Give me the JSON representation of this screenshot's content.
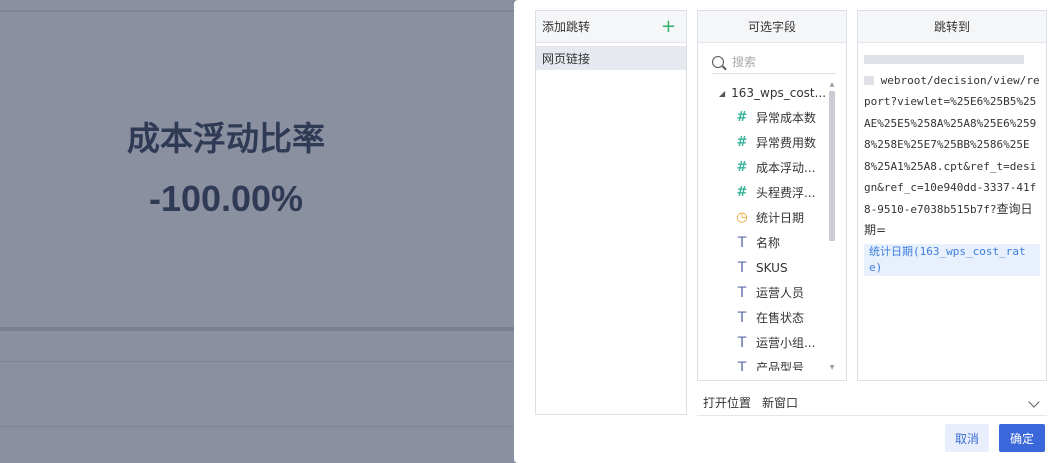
{
  "background": {
    "title": "成本浮动比率",
    "value": "-100.00%"
  },
  "jump_list": {
    "header": "添加跳转",
    "add_icon": "plus-icon",
    "items": [
      {
        "label": "网页链接"
      }
    ]
  },
  "fields": {
    "header": "可选字段",
    "search_placeholder": "搜索",
    "root_label": "163_wps_cost...",
    "items": [
      {
        "label": "异常成本数",
        "type": "number",
        "icon": "hash-icon"
      },
      {
        "label": "异常费用数",
        "type": "number",
        "icon": "hash-icon"
      },
      {
        "label": "成本浮动...",
        "type": "number",
        "icon": "hash-icon"
      },
      {
        "label": "头程费浮...",
        "type": "number",
        "icon": "hash-icon"
      },
      {
        "label": "统计日期",
        "type": "date",
        "icon": "clock-icon"
      },
      {
        "label": "名称",
        "type": "text",
        "icon": "text-type-icon"
      },
      {
        "label": "SKUS",
        "type": "text",
        "icon": "text-type-icon"
      },
      {
        "label": "运营人员",
        "type": "text",
        "icon": "text-type-icon"
      },
      {
        "label": "在售状态",
        "type": "text",
        "icon": "text-type-icon"
      },
      {
        "label": "运营小组...",
        "type": "text",
        "icon": "text-type-icon"
      },
      {
        "label": "产品型号",
        "type": "text",
        "icon": "text-type-icon"
      }
    ]
  },
  "jump_to": {
    "header": "跳转到",
    "url_path": "webroot/decision/view/report?viewlet=%25E6%25B5%25AE%25E5%258A%25A8%25E6%2598%258E%25E7%25BB%2586%25E8%25A1%25A8.cpt&ref_t=design&ref_c=10e940dd-3337-41f8-9510-e7038b515b7f?",
    "url_suffix": "查询日期=",
    "param_tag": "统计日期(163_wps_cost_rate)"
  },
  "footer": {
    "open_position_label": "打开位置",
    "open_position_value": "新窗口",
    "cancel_label": "取消",
    "ok_label": "确定"
  },
  "colors": {
    "primary": "#3a67d9",
    "accent_green": "#33b26b",
    "number_icon": "#3ab39b",
    "date_icon": "#f0a020",
    "overlay": "#8a90a0"
  }
}
